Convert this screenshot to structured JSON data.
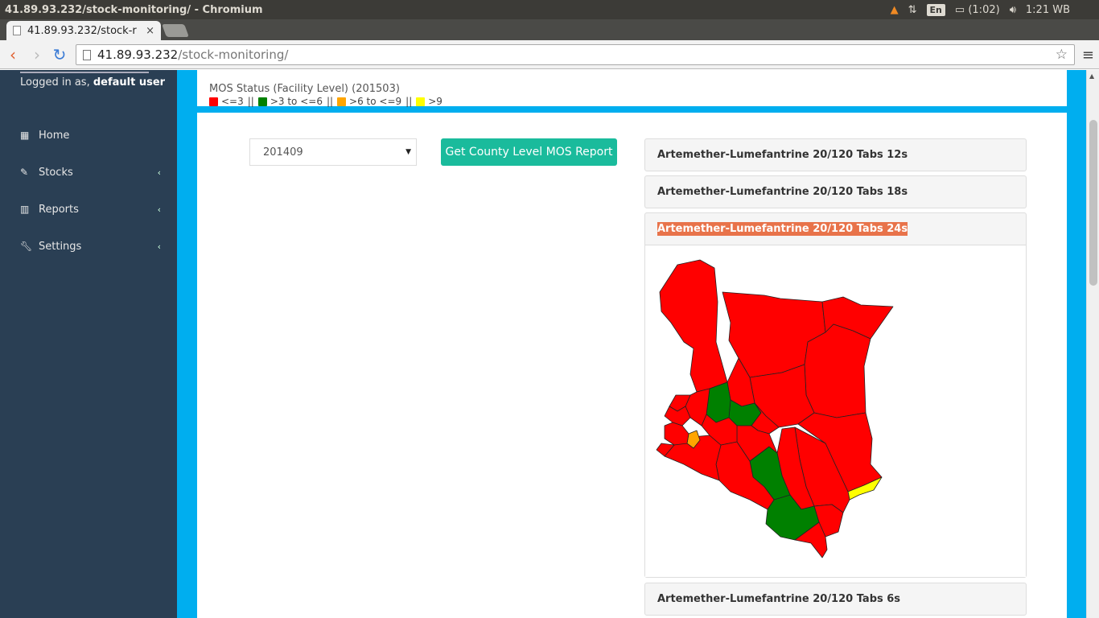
{
  "window": {
    "title": "41.89.93.232/stock-monitoring/ - Chromium"
  },
  "tray": {
    "battery": "(1:02)",
    "clock": "1:21 WB",
    "lang": "En"
  },
  "browser": {
    "tab_label": "41.89.93.232/stock-r",
    "tab_close": "×",
    "url_host": "41.89.93.232",
    "url_path": "/stock-monitoring/"
  },
  "sidebar": {
    "logged_prefix": "Logged in as, ",
    "user": "default user",
    "items": [
      {
        "label": "Home",
        "icon": "th-large-icon"
      },
      {
        "label": "Stocks",
        "icon": "edit-icon"
      },
      {
        "label": "Reports",
        "icon": "bar-chart-icon"
      },
      {
        "label": "Settings",
        "icon": "wrench-icon"
      }
    ]
  },
  "status": {
    "title": "MOS Status (Facility Level) (201503)",
    "legend": [
      {
        "label": "<=3",
        "color": "#ff0000"
      },
      {
        "label": ">3 to <=6",
        "color": "#008000"
      },
      {
        "label": ">6 to <=9",
        "color": "#ffa500"
      },
      {
        "label": ">9",
        "color": "#ffff00"
      }
    ],
    "separator": "||"
  },
  "controls": {
    "period_selected": "201409",
    "report_button": "Get County Level MOS Report"
  },
  "accordion": [
    {
      "label": "Artemether-Lumefantrine 20/120 Tabs 12s"
    },
    {
      "label": "Artemether-Lumefantrine 20/120 Tabs 18s"
    },
    {
      "label": "Artemether-Lumefantrine 20/120 Tabs 24s"
    },
    {
      "label": "Artemether-Lumefantrine 20/120 Tabs 6s"
    }
  ],
  "map_colors": {
    "low": "#ff0000",
    "mid": "#008000",
    "high": "#ffa500",
    "over": "#ffff00"
  }
}
